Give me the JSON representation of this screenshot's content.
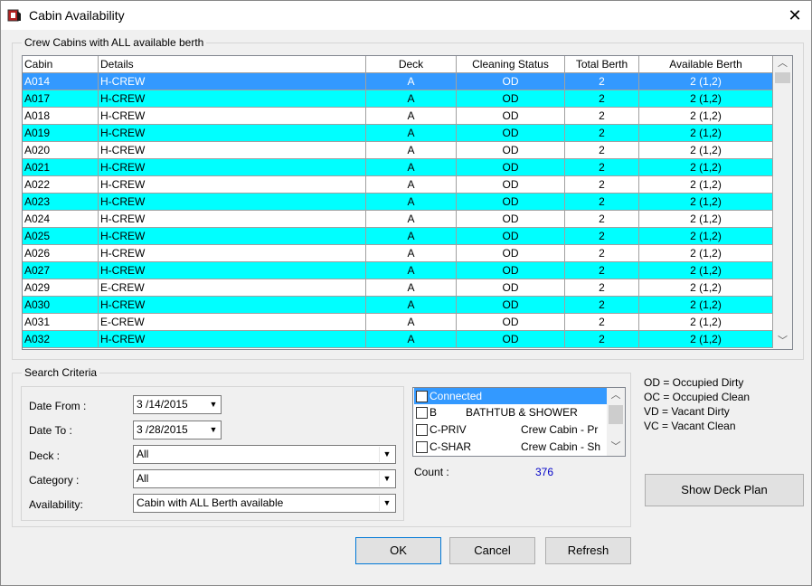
{
  "window": {
    "title": "Cabin Availability",
    "close_glyph": "✕"
  },
  "grid_group": {
    "label": "Crew Cabins with ALL available berth",
    "columns": [
      "Cabin",
      "Details",
      "Deck",
      "Cleaning Status",
      "Total Berth",
      "Available Berth"
    ],
    "rows": [
      {
        "cabin": "A014",
        "details": "H-CREW",
        "deck": "A",
        "status": "OD",
        "total": "2",
        "avail": "2 (1,2)",
        "style": "selected"
      },
      {
        "cabin": "A017",
        "details": "H-CREW",
        "deck": "A",
        "status": "OD",
        "total": "2",
        "avail": "2 (1,2)",
        "style": "cyan"
      },
      {
        "cabin": "A018",
        "details": "H-CREW",
        "deck": "A",
        "status": "OD",
        "total": "2",
        "avail": "2 (1,2)",
        "style": "white"
      },
      {
        "cabin": "A019",
        "details": "H-CREW",
        "deck": "A",
        "status": "OD",
        "total": "2",
        "avail": "2 (1,2)",
        "style": "cyan"
      },
      {
        "cabin": "A020",
        "details": "H-CREW",
        "deck": "A",
        "status": "OD",
        "total": "2",
        "avail": "2 (1,2)",
        "style": "white"
      },
      {
        "cabin": "A021",
        "details": "H-CREW",
        "deck": "A",
        "status": "OD",
        "total": "2",
        "avail": "2 (1,2)",
        "style": "cyan"
      },
      {
        "cabin": "A022",
        "details": "H-CREW",
        "deck": "A",
        "status": "OD",
        "total": "2",
        "avail": "2 (1,2)",
        "style": "white"
      },
      {
        "cabin": "A023",
        "details": "H-CREW",
        "deck": "A",
        "status": "OD",
        "total": "2",
        "avail": "2 (1,2)",
        "style": "cyan"
      },
      {
        "cabin": "A024",
        "details": "H-CREW",
        "deck": "A",
        "status": "OD",
        "total": "2",
        "avail": "2 (1,2)",
        "style": "white"
      },
      {
        "cabin": "A025",
        "details": "H-CREW",
        "deck": "A",
        "status": "OD",
        "total": "2",
        "avail": "2 (1,2)",
        "style": "cyan"
      },
      {
        "cabin": "A026",
        "details": "H-CREW",
        "deck": "A",
        "status": "OD",
        "total": "2",
        "avail": "2 (1,2)",
        "style": "white"
      },
      {
        "cabin": "A027",
        "details": "H-CREW",
        "deck": "A",
        "status": "OD",
        "total": "2",
        "avail": "2 (1,2)",
        "style": "cyan"
      },
      {
        "cabin": "A029",
        "details": "E-CREW",
        "deck": "A",
        "status": "OD",
        "total": "2",
        "avail": "2 (1,2)",
        "style": "white"
      },
      {
        "cabin": "A030",
        "details": "H-CREW",
        "deck": "A",
        "status": "OD",
        "total": "2",
        "avail": "2 (1,2)",
        "style": "cyan"
      },
      {
        "cabin": "A031",
        "details": "E-CREW",
        "deck": "A",
        "status": "OD",
        "total": "2",
        "avail": "2 (1,2)",
        "style": "white"
      },
      {
        "cabin": "A032",
        "details": "H-CREW",
        "deck": "A",
        "status": "OD",
        "total": "2",
        "avail": "2 (1,2)",
        "style": "cyan"
      }
    ]
  },
  "search": {
    "label": "Search Criteria",
    "date_from_label": "Date From :",
    "date_from_value": "3 /14/2015",
    "date_to_label": "Date To :",
    "date_to_value": "3 /28/2015",
    "deck_label": "Deck :",
    "deck_value": "All",
    "category_label": "Category :",
    "category_value": "All",
    "availability_label": "Availability:",
    "availability_value": "Cabin with ALL Berth available",
    "dropdown_glyph": "▼"
  },
  "attributes": {
    "items": [
      {
        "code": "Connected",
        "desc": "",
        "extra": "",
        "selected": true
      },
      {
        "code": "B",
        "desc": "BATHTUB & SHOWER",
        "extra": "",
        "selected": false
      },
      {
        "code": "C-PRIV",
        "desc": "",
        "extra": "Crew Cabin - Pr",
        "selected": false
      },
      {
        "code": "C-SHAR",
        "desc": "",
        "extra": "Crew Cabin - Sh",
        "selected": false
      }
    ],
    "count_label": "Count :",
    "count_value": "376"
  },
  "legend": [
    "OD = Occupied Dirty",
    "OC = Occupied Clean",
    "VD = Vacant Dirty",
    "VC = Vacant Clean"
  ],
  "buttons": {
    "show_deck_plan": "Show Deck Plan",
    "ok": "OK",
    "cancel": "Cancel",
    "refresh": "Refresh"
  },
  "colors": {
    "selected_row": "#3399ff",
    "cyan_row": "#00ffff",
    "white_row": "#ffffff",
    "count_value": "#0000c8"
  }
}
